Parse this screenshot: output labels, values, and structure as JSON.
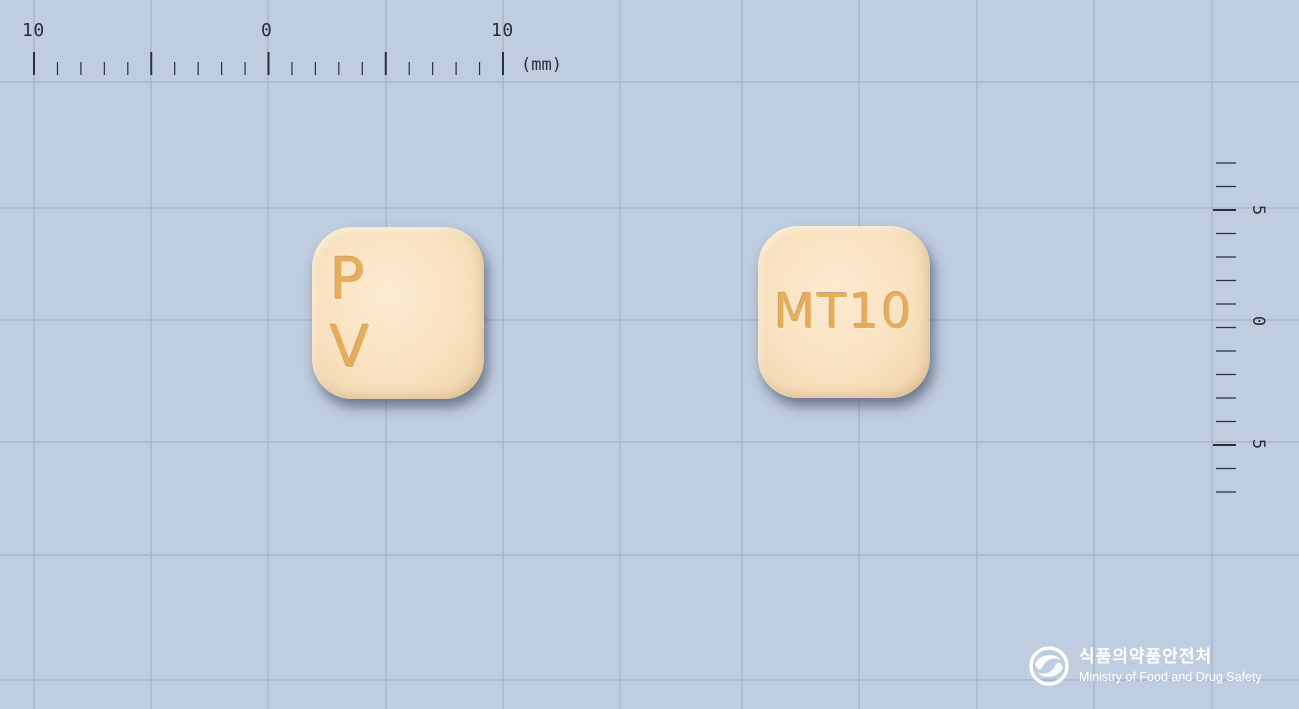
{
  "top_ruler": {
    "labels": [
      "10",
      "0",
      "10"
    ],
    "unit": "(mm)"
  },
  "right_ruler": {
    "labels": [
      "5",
      "0",
      "5"
    ]
  },
  "pills": [
    {
      "imprint": "P V",
      "color": "#f8e1bf"
    },
    {
      "imprint": "MT10",
      "color": "#f8e1bf"
    }
  ],
  "logo": {
    "korean": "식품의약품안전처",
    "english": "Ministry of Food and Drug Safety"
  },
  "colors": {
    "background": "#bfcde0",
    "grid_line": "#aab7c9",
    "ruler_ink": "#2a2f38",
    "imprint": "#e7ad5c"
  },
  "icons": {
    "logo": "taegeuk-swirl-icon"
  }
}
